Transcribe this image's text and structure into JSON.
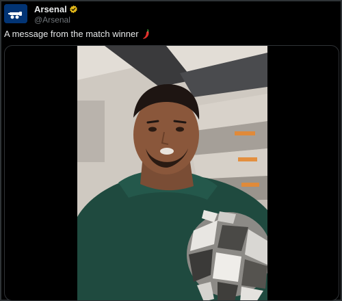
{
  "tweet": {
    "display_name": "Arsenal",
    "handle": "@Arsenal",
    "verified": true,
    "avatar_icon": "arsenal-cannon-icon",
    "text": "A message from the match winner",
    "text_emoji": "hot-pepper-emoji",
    "media": {
      "type": "video",
      "description_icon": "video-thumbnail"
    }
  },
  "colors": {
    "background": "#000000",
    "primary_text": "#e7e9ea",
    "secondary_text": "#71767b",
    "border": "#2f3336",
    "verified_badge": "#e2b719",
    "avatar_bg": "#023474"
  }
}
